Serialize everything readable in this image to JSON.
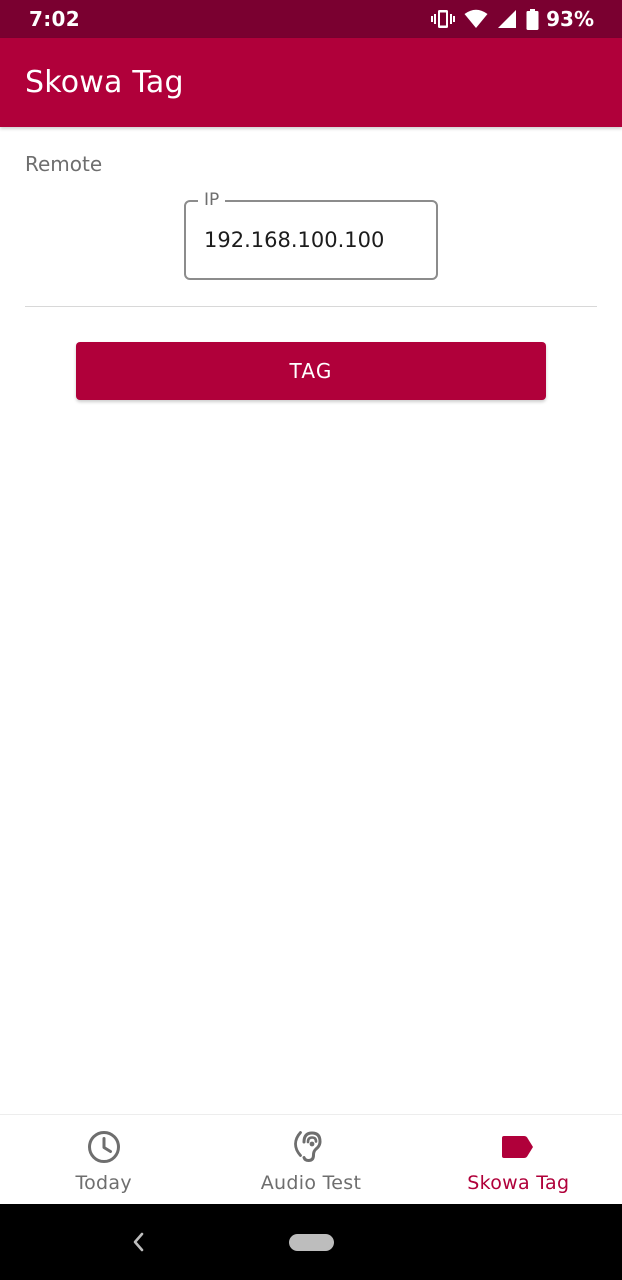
{
  "status_bar": {
    "time": "7:02",
    "battery_percent": "93%",
    "icons": [
      "vibrate-icon",
      "wifi-icon",
      "signal-icon",
      "battery-icon"
    ]
  },
  "app_bar": {
    "title": "Skowa Tag"
  },
  "remote": {
    "section_label": "Remote",
    "ip_field": {
      "label": "IP",
      "value": "192.168.100.100"
    },
    "tag_button_label": "TAG"
  },
  "bottom_nav": {
    "items": [
      {
        "label": "Today",
        "icon": "clock-icon",
        "active": false
      },
      {
        "label": "Audio Test",
        "icon": "hearing-icon",
        "active": false
      },
      {
        "label": "Skowa Tag",
        "icon": "tag-icon",
        "active": true
      }
    ]
  },
  "colors": {
    "status_bar": "#7a0030",
    "primary": "#b0003a",
    "inactive_nav": "#6e6e6e",
    "system_nav": "#000000"
  }
}
